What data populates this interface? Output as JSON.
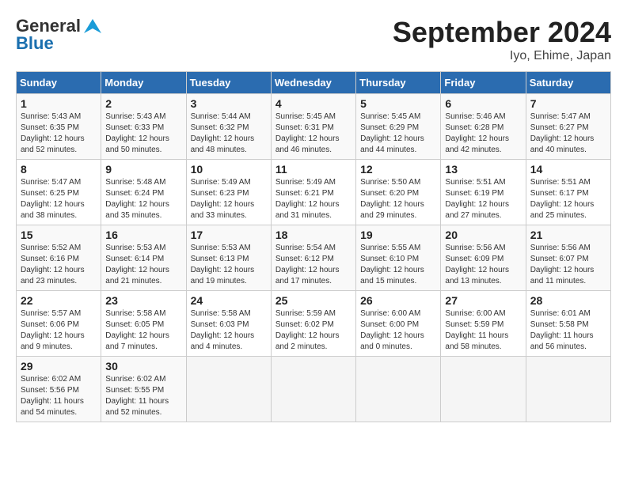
{
  "logo": {
    "line1": "General",
    "line2": "Blue"
  },
  "title": "September 2024",
  "subtitle": "Iyo, Ehime, Japan",
  "days_header": [
    "Sunday",
    "Monday",
    "Tuesday",
    "Wednesday",
    "Thursday",
    "Friday",
    "Saturday"
  ],
  "weeks": [
    [
      {
        "day": "1",
        "info": "Sunrise: 5:43 AM\nSunset: 6:35 PM\nDaylight: 12 hours\nand 52 minutes."
      },
      {
        "day": "2",
        "info": "Sunrise: 5:43 AM\nSunset: 6:33 PM\nDaylight: 12 hours\nand 50 minutes."
      },
      {
        "day": "3",
        "info": "Sunrise: 5:44 AM\nSunset: 6:32 PM\nDaylight: 12 hours\nand 48 minutes."
      },
      {
        "day": "4",
        "info": "Sunrise: 5:45 AM\nSunset: 6:31 PM\nDaylight: 12 hours\nand 46 minutes."
      },
      {
        "day": "5",
        "info": "Sunrise: 5:45 AM\nSunset: 6:29 PM\nDaylight: 12 hours\nand 44 minutes."
      },
      {
        "day": "6",
        "info": "Sunrise: 5:46 AM\nSunset: 6:28 PM\nDaylight: 12 hours\nand 42 minutes."
      },
      {
        "day": "7",
        "info": "Sunrise: 5:47 AM\nSunset: 6:27 PM\nDaylight: 12 hours\nand 40 minutes."
      }
    ],
    [
      {
        "day": "8",
        "info": "Sunrise: 5:47 AM\nSunset: 6:25 PM\nDaylight: 12 hours\nand 38 minutes."
      },
      {
        "day": "9",
        "info": "Sunrise: 5:48 AM\nSunset: 6:24 PM\nDaylight: 12 hours\nand 35 minutes."
      },
      {
        "day": "10",
        "info": "Sunrise: 5:49 AM\nSunset: 6:23 PM\nDaylight: 12 hours\nand 33 minutes."
      },
      {
        "day": "11",
        "info": "Sunrise: 5:49 AM\nSunset: 6:21 PM\nDaylight: 12 hours\nand 31 minutes."
      },
      {
        "day": "12",
        "info": "Sunrise: 5:50 AM\nSunset: 6:20 PM\nDaylight: 12 hours\nand 29 minutes."
      },
      {
        "day": "13",
        "info": "Sunrise: 5:51 AM\nSunset: 6:19 PM\nDaylight: 12 hours\nand 27 minutes."
      },
      {
        "day": "14",
        "info": "Sunrise: 5:51 AM\nSunset: 6:17 PM\nDaylight: 12 hours\nand 25 minutes."
      }
    ],
    [
      {
        "day": "15",
        "info": "Sunrise: 5:52 AM\nSunset: 6:16 PM\nDaylight: 12 hours\nand 23 minutes."
      },
      {
        "day": "16",
        "info": "Sunrise: 5:53 AM\nSunset: 6:14 PM\nDaylight: 12 hours\nand 21 minutes."
      },
      {
        "day": "17",
        "info": "Sunrise: 5:53 AM\nSunset: 6:13 PM\nDaylight: 12 hours\nand 19 minutes."
      },
      {
        "day": "18",
        "info": "Sunrise: 5:54 AM\nSunset: 6:12 PM\nDaylight: 12 hours\nand 17 minutes."
      },
      {
        "day": "19",
        "info": "Sunrise: 5:55 AM\nSunset: 6:10 PM\nDaylight: 12 hours\nand 15 minutes."
      },
      {
        "day": "20",
        "info": "Sunrise: 5:56 AM\nSunset: 6:09 PM\nDaylight: 12 hours\nand 13 minutes."
      },
      {
        "day": "21",
        "info": "Sunrise: 5:56 AM\nSunset: 6:07 PM\nDaylight: 12 hours\nand 11 minutes."
      }
    ],
    [
      {
        "day": "22",
        "info": "Sunrise: 5:57 AM\nSunset: 6:06 PM\nDaylight: 12 hours\nand 9 minutes."
      },
      {
        "day": "23",
        "info": "Sunrise: 5:58 AM\nSunset: 6:05 PM\nDaylight: 12 hours\nand 7 minutes."
      },
      {
        "day": "24",
        "info": "Sunrise: 5:58 AM\nSunset: 6:03 PM\nDaylight: 12 hours\nand 4 minutes."
      },
      {
        "day": "25",
        "info": "Sunrise: 5:59 AM\nSunset: 6:02 PM\nDaylight: 12 hours\nand 2 minutes."
      },
      {
        "day": "26",
        "info": "Sunrise: 6:00 AM\nSunset: 6:00 PM\nDaylight: 12 hours\nand 0 minutes."
      },
      {
        "day": "27",
        "info": "Sunrise: 6:00 AM\nSunset: 5:59 PM\nDaylight: 11 hours\nand 58 minutes."
      },
      {
        "day": "28",
        "info": "Sunrise: 6:01 AM\nSunset: 5:58 PM\nDaylight: 11 hours\nand 56 minutes."
      }
    ],
    [
      {
        "day": "29",
        "info": "Sunrise: 6:02 AM\nSunset: 5:56 PM\nDaylight: 11 hours\nand 54 minutes."
      },
      {
        "day": "30",
        "info": "Sunrise: 6:02 AM\nSunset: 5:55 PM\nDaylight: 11 hours\nand 52 minutes."
      },
      {
        "day": "",
        "info": ""
      },
      {
        "day": "",
        "info": ""
      },
      {
        "day": "",
        "info": ""
      },
      {
        "day": "",
        "info": ""
      },
      {
        "day": "",
        "info": ""
      }
    ]
  ]
}
